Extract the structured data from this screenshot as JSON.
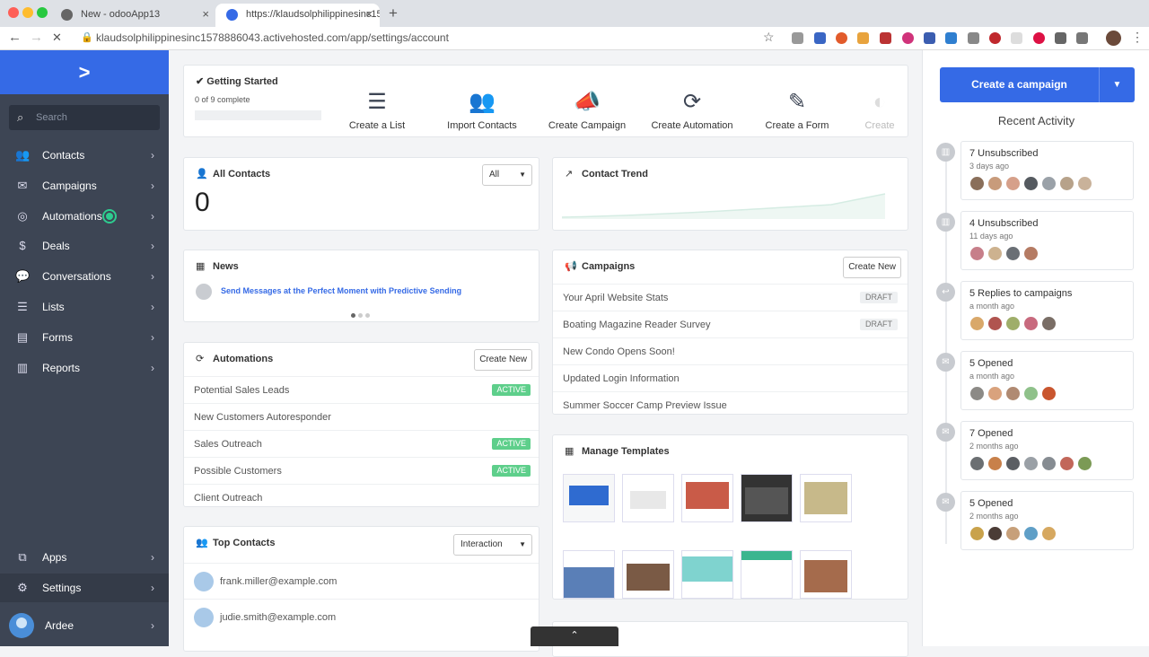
{
  "browser": {
    "tabs": [
      {
        "title": "New - odooApp13",
        "close": "×"
      },
      {
        "title": "https://klaudsolphilippinesinc15",
        "close": "×"
      }
    ],
    "new_tab": "+",
    "back": "←",
    "forward": "→",
    "reload": "✕",
    "url": "klaudsolphilippinesinc1578886043.activehosted.com/app/settings/account",
    "bookmark": "☆",
    "menu": "⋮"
  },
  "sidebar": {
    "logo": ">",
    "search_placeholder": "Search",
    "items": [
      {
        "label": "Contacts",
        "icon": "contacts-icon",
        "glyph": "👥"
      },
      {
        "label": "Campaigns",
        "icon": "envelope-icon",
        "glyph": "✉"
      },
      {
        "label": "Automations",
        "icon": "automations-icon",
        "glyph": "◎"
      },
      {
        "label": "Deals",
        "icon": "dollar-icon",
        "glyph": "$"
      },
      {
        "label": "Conversations",
        "icon": "chat-icon",
        "glyph": "💬"
      },
      {
        "label": "Lists",
        "icon": "list-icon",
        "glyph": "☰"
      },
      {
        "label": "Forms",
        "icon": "form-icon",
        "glyph": "▤"
      },
      {
        "label": "Reports",
        "icon": "reports-icon",
        "glyph": "▥"
      }
    ],
    "apps": {
      "label": "Apps",
      "glyph": "⧉"
    },
    "settings": {
      "label": "Settings",
      "glyph": "⚙"
    },
    "user": {
      "label": "Ardee"
    },
    "chevron": "›"
  },
  "getting_started": {
    "title": "✔ Getting Started",
    "progress_text": "0 of 9 complete",
    "progress": 0
  },
  "quick_actions": [
    {
      "label": "Create a List",
      "icon": "list-icon",
      "glyph": "☰"
    },
    {
      "label": "Import Contacts",
      "icon": "users-icon",
      "glyph": "👥"
    },
    {
      "label": "Create Campaign",
      "icon": "megaphone-icon",
      "glyph": "📣"
    },
    {
      "label": "Create Automation",
      "icon": "refresh-icon",
      "glyph": "⟳"
    },
    {
      "label": "Create a Form",
      "icon": "pencil-icon",
      "glyph": "✎"
    },
    {
      "label": "Create",
      "icon": "more-icon",
      "glyph": "◐"
    }
  ],
  "all_contacts": {
    "title": "All Contacts",
    "filter": "All",
    "count": "0",
    "icon": "👤"
  },
  "contact_trend": {
    "title": "Contact Trend",
    "icon": "↗"
  },
  "news": {
    "title": "News",
    "icon": "▦",
    "headline": "Send Messages at the Perfect Moment with Predictive Sending"
  },
  "campaigns": {
    "title": "Campaigns",
    "icon": "📢",
    "button": "Create New",
    "rows": [
      {
        "name": "Your April Website Stats",
        "status": "DRAFT"
      },
      {
        "name": "Boating Magazine Reader Survey",
        "status": "DRAFT"
      },
      {
        "name": "New Condo Opens Soon!",
        "status": ""
      },
      {
        "name": "Updated Login Information",
        "status": ""
      },
      {
        "name": "Summer Soccer Camp Preview Issue",
        "status": ""
      }
    ]
  },
  "automations": {
    "title": "Automations",
    "icon": "⟳",
    "button": "Create New",
    "rows": [
      {
        "name": "Potential Sales Leads",
        "status": "ACTIVE"
      },
      {
        "name": "New Customers Autoresponder",
        "status": ""
      },
      {
        "name": "Sales Outreach",
        "status": "ACTIVE"
      },
      {
        "name": "Possible Customers",
        "status": "ACTIVE"
      },
      {
        "name": "Client Outreach",
        "status": ""
      }
    ]
  },
  "manage_templates": {
    "title": "Manage Templates",
    "icon": "▦"
  },
  "top_contacts": {
    "title": "Top Contacts",
    "icon": "👥",
    "filter": "Interaction",
    "rows": [
      {
        "email": "frank.miller@example.com"
      },
      {
        "email": "judie.smith@example.com"
      }
    ]
  },
  "right_panel": {
    "create_button": "Create a campaign",
    "dropdown": "▼",
    "recent_title": "Recent Activity",
    "activities": [
      {
        "title": "7 Unsubscribed",
        "time": "3 days ago",
        "icon": "▥",
        "avatars": [
          "#8a6f5a",
          "#c89b7b",
          "#d6a08a",
          "#555a60",
          "#9aa1a8",
          "#b7a28a",
          "#c9b29a"
        ]
      },
      {
        "title": "4 Unsubscribed",
        "time": "11 days ago",
        "icon": "▥",
        "avatars": [
          "#c77f8a",
          "#cdb28f",
          "#6a6f75",
          "#b57b63"
        ]
      },
      {
        "title": "5 Replies to campaigns",
        "time": "a month ago",
        "icon": "↩",
        "avatars": [
          "#d9a86a",
          "#b0544f",
          "#9fae6a",
          "#c86a7e",
          "#7a6e66"
        ]
      },
      {
        "title": "5 Opened",
        "time": "a month ago",
        "icon": "✉",
        "avatars": [
          "#8c8a86",
          "#d9a27d",
          "#b08a72",
          "#8fc18a",
          "#c9562f"
        ]
      },
      {
        "title": "7 Opened",
        "time": "2 months ago",
        "icon": "✉",
        "avatars": [
          "#6b6f72",
          "#c8804a",
          "#5b5e63",
          "#9aa0a6",
          "#868c92",
          "#c2675a",
          "#7b9a55"
        ]
      },
      {
        "title": "5 Opened",
        "time": "2 months ago",
        "icon": "✉",
        "avatars": [
          "#c9a24b",
          "#4b3c36",
          "#c7a07a",
          "#5f9fc7",
          "#d6a860"
        ]
      }
    ]
  },
  "bottom_tab": "⌃",
  "colors": {
    "brand_blue": "#356ae6",
    "sidebar": "#3d4554",
    "active_green": "#5ecf8b"
  }
}
